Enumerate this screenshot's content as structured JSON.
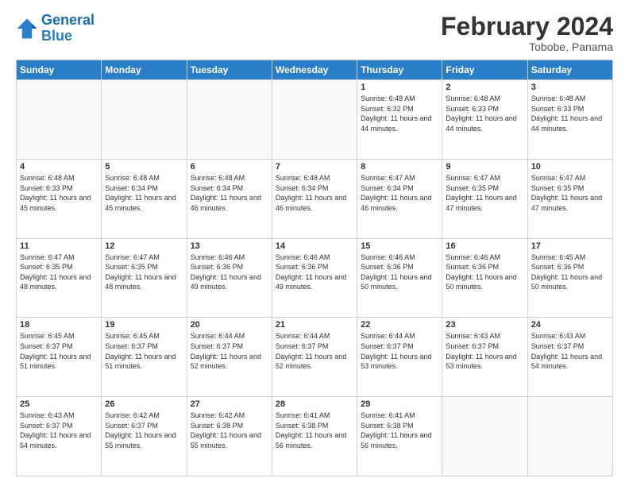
{
  "header": {
    "logo_line1": "General",
    "logo_line2": "Blue",
    "month_title": "February 2024",
    "subtitle": "Tobobe, Panama"
  },
  "weekdays": [
    "Sunday",
    "Monday",
    "Tuesday",
    "Wednesday",
    "Thursday",
    "Friday",
    "Saturday"
  ],
  "weeks": [
    [
      {
        "day": "",
        "sunrise": "",
        "sunset": "",
        "daylight": ""
      },
      {
        "day": "",
        "sunrise": "",
        "sunset": "",
        "daylight": ""
      },
      {
        "day": "",
        "sunrise": "",
        "sunset": "",
        "daylight": ""
      },
      {
        "day": "",
        "sunrise": "",
        "sunset": "",
        "daylight": ""
      },
      {
        "day": "1",
        "sunrise": "Sunrise: 6:48 AM",
        "sunset": "Sunset: 6:32 PM",
        "daylight": "Daylight: 11 hours and 44 minutes."
      },
      {
        "day": "2",
        "sunrise": "Sunrise: 6:48 AM",
        "sunset": "Sunset: 6:33 PM",
        "daylight": "Daylight: 11 hours and 44 minutes."
      },
      {
        "day": "3",
        "sunrise": "Sunrise: 6:48 AM",
        "sunset": "Sunset: 6:33 PM",
        "daylight": "Daylight: 11 hours and 44 minutes."
      }
    ],
    [
      {
        "day": "4",
        "sunrise": "Sunrise: 6:48 AM",
        "sunset": "Sunset: 6:33 PM",
        "daylight": "Daylight: 11 hours and 45 minutes."
      },
      {
        "day": "5",
        "sunrise": "Sunrise: 6:48 AM",
        "sunset": "Sunset: 6:34 PM",
        "daylight": "Daylight: 11 hours and 45 minutes."
      },
      {
        "day": "6",
        "sunrise": "Sunrise: 6:48 AM",
        "sunset": "Sunset: 6:34 PM",
        "daylight": "Daylight: 11 hours and 46 minutes."
      },
      {
        "day": "7",
        "sunrise": "Sunrise: 6:48 AM",
        "sunset": "Sunset: 6:34 PM",
        "daylight": "Daylight: 11 hours and 46 minutes."
      },
      {
        "day": "8",
        "sunrise": "Sunrise: 6:47 AM",
        "sunset": "Sunset: 6:34 PM",
        "daylight": "Daylight: 11 hours and 46 minutes."
      },
      {
        "day": "9",
        "sunrise": "Sunrise: 6:47 AM",
        "sunset": "Sunset: 6:35 PM",
        "daylight": "Daylight: 11 hours and 47 minutes."
      },
      {
        "day": "10",
        "sunrise": "Sunrise: 6:47 AM",
        "sunset": "Sunset: 6:35 PM",
        "daylight": "Daylight: 11 hours and 47 minutes."
      }
    ],
    [
      {
        "day": "11",
        "sunrise": "Sunrise: 6:47 AM",
        "sunset": "Sunset: 6:35 PM",
        "daylight": "Daylight: 11 hours and 48 minutes."
      },
      {
        "day": "12",
        "sunrise": "Sunrise: 6:47 AM",
        "sunset": "Sunset: 6:35 PM",
        "daylight": "Daylight: 11 hours and 48 minutes."
      },
      {
        "day": "13",
        "sunrise": "Sunrise: 6:46 AM",
        "sunset": "Sunset: 6:36 PM",
        "daylight": "Daylight: 11 hours and 49 minutes."
      },
      {
        "day": "14",
        "sunrise": "Sunrise: 6:46 AM",
        "sunset": "Sunset: 6:36 PM",
        "daylight": "Daylight: 11 hours and 49 minutes."
      },
      {
        "day": "15",
        "sunrise": "Sunrise: 6:46 AM",
        "sunset": "Sunset: 6:36 PM",
        "daylight": "Daylight: 11 hours and 50 minutes."
      },
      {
        "day": "16",
        "sunrise": "Sunrise: 6:46 AM",
        "sunset": "Sunset: 6:36 PM",
        "daylight": "Daylight: 11 hours and 50 minutes."
      },
      {
        "day": "17",
        "sunrise": "Sunrise: 6:45 AM",
        "sunset": "Sunset: 6:36 PM",
        "daylight": "Daylight: 11 hours and 50 minutes."
      }
    ],
    [
      {
        "day": "18",
        "sunrise": "Sunrise: 6:45 AM",
        "sunset": "Sunset: 6:37 PM",
        "daylight": "Daylight: 11 hours and 51 minutes."
      },
      {
        "day": "19",
        "sunrise": "Sunrise: 6:45 AM",
        "sunset": "Sunset: 6:37 PM",
        "daylight": "Daylight: 11 hours and 51 minutes."
      },
      {
        "day": "20",
        "sunrise": "Sunrise: 6:44 AM",
        "sunset": "Sunset: 6:37 PM",
        "daylight": "Daylight: 11 hours and 52 minutes."
      },
      {
        "day": "21",
        "sunrise": "Sunrise: 6:44 AM",
        "sunset": "Sunset: 6:37 PM",
        "daylight": "Daylight: 11 hours and 52 minutes."
      },
      {
        "day": "22",
        "sunrise": "Sunrise: 6:44 AM",
        "sunset": "Sunset: 6:37 PM",
        "daylight": "Daylight: 11 hours and 53 minutes."
      },
      {
        "day": "23",
        "sunrise": "Sunrise: 6:43 AM",
        "sunset": "Sunset: 6:37 PM",
        "daylight": "Daylight: 11 hours and 53 minutes."
      },
      {
        "day": "24",
        "sunrise": "Sunrise: 6:43 AM",
        "sunset": "Sunset: 6:37 PM",
        "daylight": "Daylight: 11 hours and 54 minutes."
      }
    ],
    [
      {
        "day": "25",
        "sunrise": "Sunrise: 6:43 AM",
        "sunset": "Sunset: 6:37 PM",
        "daylight": "Daylight: 11 hours and 54 minutes."
      },
      {
        "day": "26",
        "sunrise": "Sunrise: 6:42 AM",
        "sunset": "Sunset: 6:37 PM",
        "daylight": "Daylight: 11 hours and 55 minutes."
      },
      {
        "day": "27",
        "sunrise": "Sunrise: 6:42 AM",
        "sunset": "Sunset: 6:38 PM",
        "daylight": "Daylight: 11 hours and 55 minutes."
      },
      {
        "day": "28",
        "sunrise": "Sunrise: 6:41 AM",
        "sunset": "Sunset: 6:38 PM",
        "daylight": "Daylight: 11 hours and 56 minutes."
      },
      {
        "day": "29",
        "sunrise": "Sunrise: 6:41 AM",
        "sunset": "Sunset: 6:38 PM",
        "daylight": "Daylight: 11 hours and 56 minutes."
      },
      {
        "day": "",
        "sunrise": "",
        "sunset": "",
        "daylight": ""
      },
      {
        "day": "",
        "sunrise": "",
        "sunset": "",
        "daylight": ""
      }
    ]
  ]
}
